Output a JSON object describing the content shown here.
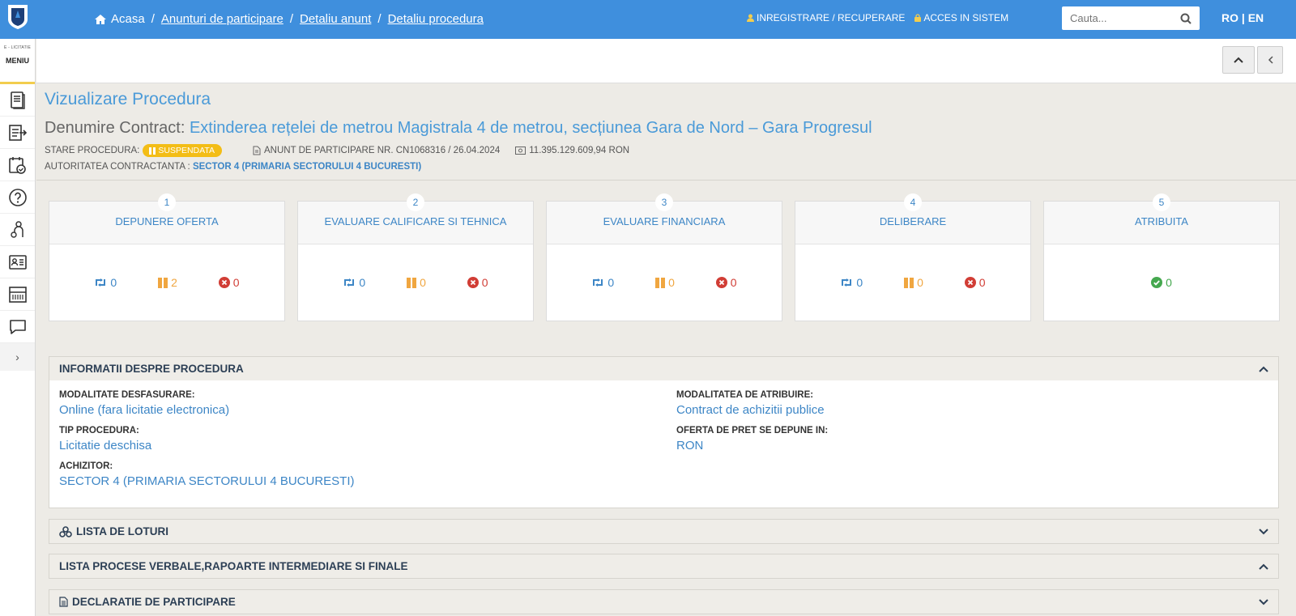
{
  "brand": {
    "small_text": "E - LICITATIE",
    "menu_label": "MENIU"
  },
  "breadcrumb": {
    "home": "Acasa",
    "items": [
      "Anunturi de participare",
      "Detaliu anunt",
      "Detaliu procedura"
    ]
  },
  "top_links": {
    "register": "INREGISTRARE / RECUPERARE",
    "login": "ACCES IN SISTEM"
  },
  "search": {
    "placeholder": "Cauta..."
  },
  "lang": {
    "ro": "RO",
    "sep": "|",
    "en": "EN"
  },
  "page": {
    "title": "Vizualizare Procedura",
    "contract_label": "Denumire Contract:",
    "contract_name": "Extinderea rețelei de metrou Magistrala 4 de metrou, secțiunea Gara de Nord – Gara Progresul",
    "status_label": "STARE PROCEDURA:",
    "status_value": "SUSPENDATA",
    "notice": "ANUNT DE PARTICIPARE NR. CN1068316 / 26.04.2024",
    "value": "11.395.129.609,94  RON",
    "authority_label": "AUTORITATEA CONTRACTANTA :",
    "authority_value": "SECTOR 4 (PRIMARIA SECTORULUI 4 BUCURESTI)"
  },
  "steps": [
    {
      "num": "1",
      "title": "DEPUNERE OFERTA",
      "c1": "0",
      "c2": "2",
      "c3": "0"
    },
    {
      "num": "2",
      "title": "EVALUARE CALIFICARE SI TEHNICA",
      "c1": "0",
      "c2": "0",
      "c3": "0"
    },
    {
      "num": "3",
      "title": "EVALUARE FINANCIARA",
      "c1": "0",
      "c2": "0",
      "c3": "0"
    },
    {
      "num": "4",
      "title": "DELIBERARE",
      "c1": "0",
      "c2": "0",
      "c3": "0"
    },
    {
      "num": "5",
      "title": "ATRIBUITA",
      "ok": "0"
    }
  ],
  "info": {
    "title": "INFORMATII DESPRE PROCEDURA",
    "mod_desf_label": "MODALITATE DESFASURARE:",
    "mod_desf_value": "Online (fara licitatie electronica)",
    "tip_label": "TIP PROCEDURA:",
    "tip_value": "Licitatie deschisa",
    "achizitor_label": "ACHIZITOR:",
    "achizitor_value": "SECTOR 4 (PRIMARIA SECTORULUI 4 BUCURESTI)",
    "mod_atr_label": "MODALITATEA DE ATRIBUIRE:",
    "mod_atr_value": "Contract de achizitii publice",
    "oferta_label": "OFERTA DE PRET SE DEPUNE IN:",
    "oferta_value": "RON"
  },
  "panels": {
    "loturi": "LISTA DE LOTURI",
    "procese": "LISTA PROCESE VERBALE,RAPOARTE INTERMEDIARE SI FINALE",
    "declaratie": "DECLARATIE DE PARTICIPARE"
  },
  "colors": {
    "topbar": "#3f8fdd",
    "accent": "#4a9ad8",
    "suspended": "#f3bd16",
    "orange": "#f0a640",
    "red": "#d13d35",
    "green": "#45a84f"
  }
}
